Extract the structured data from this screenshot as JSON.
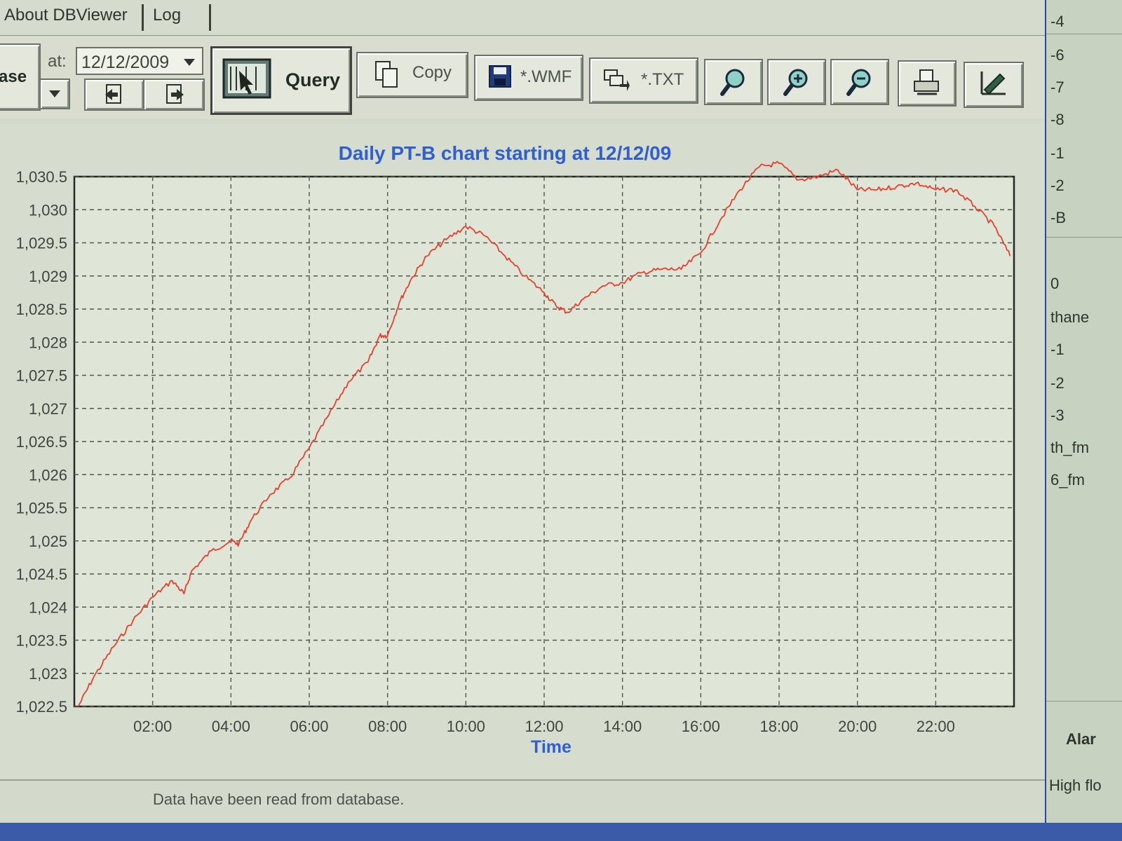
{
  "menu": {
    "items": [
      "About DBViewer",
      "Log"
    ]
  },
  "toolbar": {
    "left_partial_label": "ase",
    "at_label": "at:",
    "date_value": "12/12/2009",
    "query_label": "Query",
    "copy_label": "Copy",
    "wmf_label": "*.WMF",
    "txt_label": "*.TXT"
  },
  "chart_data": {
    "type": "line",
    "title": "Daily PT-B chart starting at 12/12/09",
    "xlabel": "Time",
    "ylabel": "",
    "xlim": [
      0.0,
      24.0
    ],
    "ylim": [
      1022.5,
      1030.5
    ],
    "x_ticks": [
      2,
      4,
      6,
      8,
      10,
      12,
      14,
      16,
      18,
      20,
      22
    ],
    "x_tick_labels": [
      "02:00",
      "04:00",
      "06:00",
      "08:00",
      "10:00",
      "12:00",
      "14:00",
      "16:00",
      "18:00",
      "20:00",
      "22:00"
    ],
    "y_ticks": [
      1022.5,
      1023,
      1023.5,
      1024,
      1024.5,
      1025,
      1025.5,
      1026,
      1026.5,
      1027,
      1027.5,
      1028,
      1028.5,
      1029,
      1029.5,
      1030,
      1030.5
    ],
    "y_tick_labels": [
      "1,022.5",
      "1,023",
      "1,023.5",
      "1,024",
      "1,024.5",
      "1,025",
      "1,025.5",
      "1,026",
      "1,026.5",
      "1,027",
      "1,027.5",
      "1,028",
      "1,028.5",
      "1,029",
      "1,029.5",
      "1,030",
      "1,030.5"
    ],
    "grid": true,
    "series": [
      {
        "color": "#e8402b",
        "x": [
          0.1,
          0.5,
          1.0,
          1.5,
          2.0,
          2.5,
          2.8,
          3.0,
          3.5,
          4.0,
          4.2,
          4.5,
          5.0,
          5.5,
          6.0,
          6.5,
          7.0,
          7.5,
          7.8,
          8.0,
          8.3,
          8.6,
          9.0,
          9.5,
          10.0,
          10.5,
          11.0,
          11.5,
          12.0,
          12.3,
          12.6,
          13.0,
          13.5,
          14.0,
          14.5,
          15.0,
          15.5,
          16.0,
          16.5,
          17.0,
          17.5,
          18.0,
          18.5,
          19.0,
          19.5,
          20.0,
          20.5,
          21.0,
          21.5,
          22.0,
          22.5,
          23.0,
          23.5,
          23.9
        ],
        "y": [
          1022.5,
          1022.95,
          1023.4,
          1023.8,
          1024.15,
          1024.4,
          1024.2,
          1024.55,
          1024.85,
          1025.0,
          1024.95,
          1025.3,
          1025.7,
          1025.95,
          1026.4,
          1026.9,
          1027.4,
          1027.7,
          1028.1,
          1028.1,
          1028.6,
          1028.95,
          1029.3,
          1029.55,
          1029.75,
          1029.6,
          1029.3,
          1029.0,
          1028.75,
          1028.55,
          1028.45,
          1028.65,
          1028.85,
          1028.9,
          1029.05,
          1029.1,
          1029.1,
          1029.35,
          1029.85,
          1030.3,
          1030.65,
          1030.7,
          1030.45,
          1030.5,
          1030.6,
          1030.3,
          1030.3,
          1030.35,
          1030.4,
          1030.3,
          1030.3,
          1030.05,
          1029.75,
          1029.3
        ]
      }
    ]
  },
  "status": {
    "text": "Data have been read from database."
  },
  "right_panel": {
    "labels": [
      "-4",
      "-6",
      "-7",
      "-8",
      "-1",
      "-2",
      "-B",
      "0",
      "thane",
      "-1",
      "-2",
      "-3",
      "th_fm",
      "6_fm"
    ],
    "alarm_label": "Alar",
    "high_label": "High flo"
  }
}
